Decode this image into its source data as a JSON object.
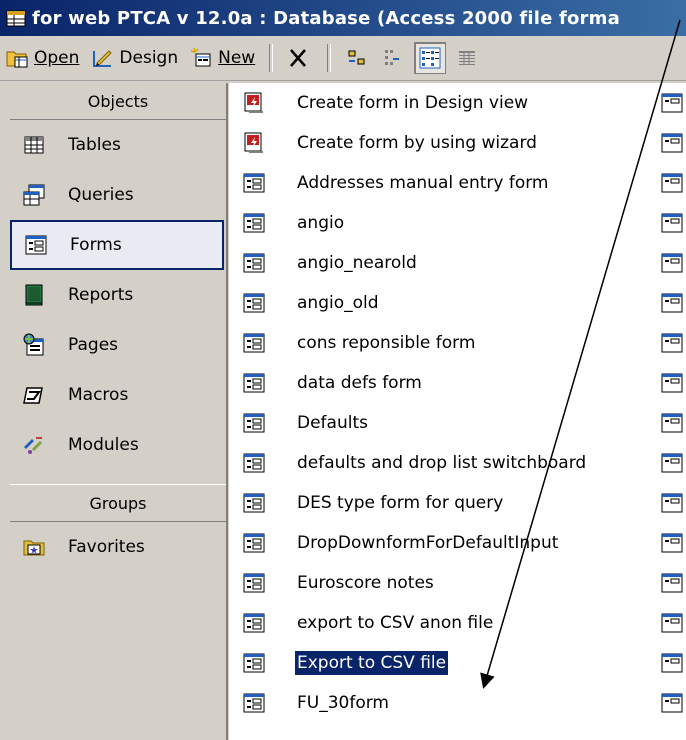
{
  "title": "for web PTCA v 12.0a : Database (Access 2000 file forma",
  "toolbar": {
    "open": "Open",
    "design": "Design",
    "new": "New"
  },
  "objects_header": "Objects",
  "groups_header": "Groups",
  "nav": [
    {
      "label": "Tables",
      "icon": "table-icon"
    },
    {
      "label": "Queries",
      "icon": "query-icon"
    },
    {
      "label": "Forms",
      "icon": "form-icon",
      "selected": true
    },
    {
      "label": "Reports",
      "icon": "report-icon"
    },
    {
      "label": "Pages",
      "icon": "page-icon"
    },
    {
      "label": "Macros",
      "icon": "macro-icon"
    },
    {
      "label": "Modules",
      "icon": "module-icon"
    }
  ],
  "favorites": "Favorites",
  "forms": [
    "Create form in Design view",
    "Create form by using wizard",
    "Addresses manual entry form",
    "angio",
    "angio_nearold",
    "angio_old",
    "cons reponsible form",
    "data defs form",
    "Defaults",
    "defaults and drop list switchboard",
    "DES type form for query",
    "DropDownformForDefaultInput",
    "Euroscore notes",
    "export to CSV anon file",
    "Export to CSV file",
    "FU_30form"
  ],
  "selected_form": "Export to CSV file"
}
